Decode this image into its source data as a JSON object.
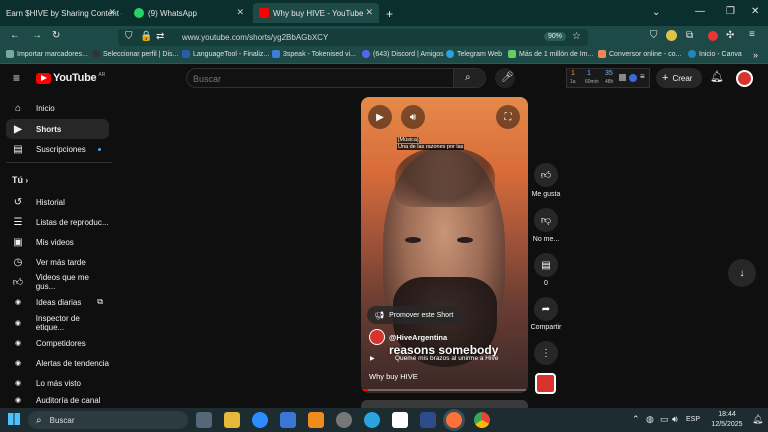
{
  "browser": {
    "tabs": [
      {
        "title": "Earn $HIVE by Sharing Content - G..."
      },
      {
        "title": "(9) WhatsApp"
      },
      {
        "title": "Why buy HIVE - YouTube"
      }
    ],
    "url": "www.youtube.com/shorts/yg2BbAGbXCY",
    "zoom": "90%",
    "bookmarks": [
      "Importar marcadores...",
      "Seleccionar perfil | Dis...",
      "LanguageTool - Finaliz...",
      "3speak - Tokenised vi...",
      "(643) Discord | Amigos",
      "Telegram Web",
      "Más de 1 millón de Im...",
      "Conversor online - co...",
      "Inicio - Canva"
    ]
  },
  "youtube": {
    "logo_text": "YouTube",
    "region": "AR",
    "search_placeholder": "Buscar",
    "create_label": "Crear",
    "header_widget": {
      "a": "1",
      "a_sub": "1a",
      "b": "1",
      "b_sub": "60min",
      "c": "35",
      "c_sub": "48h"
    },
    "sidebar": {
      "main": [
        "Inicio",
        "Shorts",
        "Suscripciones"
      ],
      "you_header": "Tú",
      "you": [
        "Historial",
        "Listas de reproduc...",
        "Mis videos",
        "Ver más tarde",
        "Videos que me gus..."
      ],
      "extensions": [
        "Ideas diarias",
        "Inspector de etique...",
        "Competidores",
        "Alertas de tendencia",
        "Lo más visto",
        "Auditoría de canal"
      ]
    },
    "short": {
      "caption_1": "[Música]",
      "caption_2": "Una de las razones por las",
      "promote": "Promover este Short",
      "channel": "@HiveArgentina",
      "overlay_text": "reasons somebody",
      "sub_caption": "Quemé mis brazos al unirme a Hive",
      "title": "Why buy HIVE"
    },
    "actions": {
      "like": "Me gusta",
      "dislike": "No me...",
      "comments": "0",
      "share": "Compartir"
    }
  },
  "taskbar": {
    "search": "Buscar",
    "lang": "ESP",
    "time": "18:44",
    "date": "12/5/2025"
  }
}
